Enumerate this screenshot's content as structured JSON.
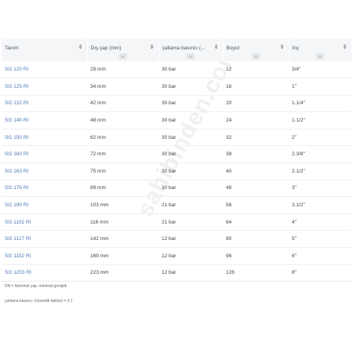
{
  "table": {
    "columns": [
      {
        "label": "Tanım"
      },
      {
        "label": "Dış çap (mm)"
      },
      {
        "label": "çatlama basıncı (..."
      },
      {
        "label": "Boyut"
      },
      {
        "label": "İnç"
      }
    ],
    "rows": [
      {
        "name": "SG 120 RI",
        "diameter": "29  mm",
        "pressure": "30  bar",
        "size": "12",
        "inch": "3/4\""
      },
      {
        "name": "SG 125 RI",
        "diameter": "34  mm",
        "pressure": "30  bar",
        "size": "16",
        "inch": "1\""
      },
      {
        "name": "SG 132 RI",
        "diameter": "42  mm",
        "pressure": "30  bar",
        "size": "20",
        "inch": "1.1/4\""
      },
      {
        "name": "SG 140 RI",
        "diameter": "48  mm",
        "pressure": "30  bar",
        "size": "24",
        "inch": "1.1/2\""
      },
      {
        "name": "SG 150 RI",
        "diameter": "62  mm",
        "pressure": "30  bar",
        "size": "32",
        "inch": "2\""
      },
      {
        "name": "SG 160 RI",
        "diameter": "72  mm",
        "pressure": "30  bar",
        "size": "38",
        "inch": "2.3/8\""
      },
      {
        "name": "SG 163 RI",
        "diameter": "75  mm",
        "pressure": "30  bar",
        "size": "40",
        "inch": "2.1/2\""
      },
      {
        "name": "SG 176 RI",
        "diameter": "89  mm",
        "pressure": "30  bar",
        "size": "48",
        "inch": "3\""
      },
      {
        "name": "SG 190 RI",
        "diameter": "103  mm",
        "pressure": "21  bar",
        "size": "56",
        "inch": "3.1/2\""
      },
      {
        "name": "SG 1102 RI",
        "diameter": "116  mm",
        "pressure": "21  bar",
        "size": "64",
        "inch": "4\""
      },
      {
        "name": "SG 1127 RI",
        "diameter": "142  mm",
        "pressure": "12  bar",
        "size": "80",
        "inch": "5\""
      },
      {
        "name": "SG 1152 RI",
        "diameter": "169  mm",
        "pressure": "12  bar",
        "size": "96",
        "inch": "6\""
      },
      {
        "name": "SG 1203 RI",
        "diameter": "223  mm",
        "pressure": "12  bar",
        "size": "128",
        "inch": "8\""
      }
    ]
  },
  "notes": {
    "dn": "DN = Nominal çap, nominal genişlik",
    "pressure": "çatlama basıncı: Güvenlik faktörü = 3:1"
  },
  "watermark": "sahibinden.com",
  "icons": {
    "sort": "sort-icon",
    "chevron": "chevron-down-icon"
  }
}
